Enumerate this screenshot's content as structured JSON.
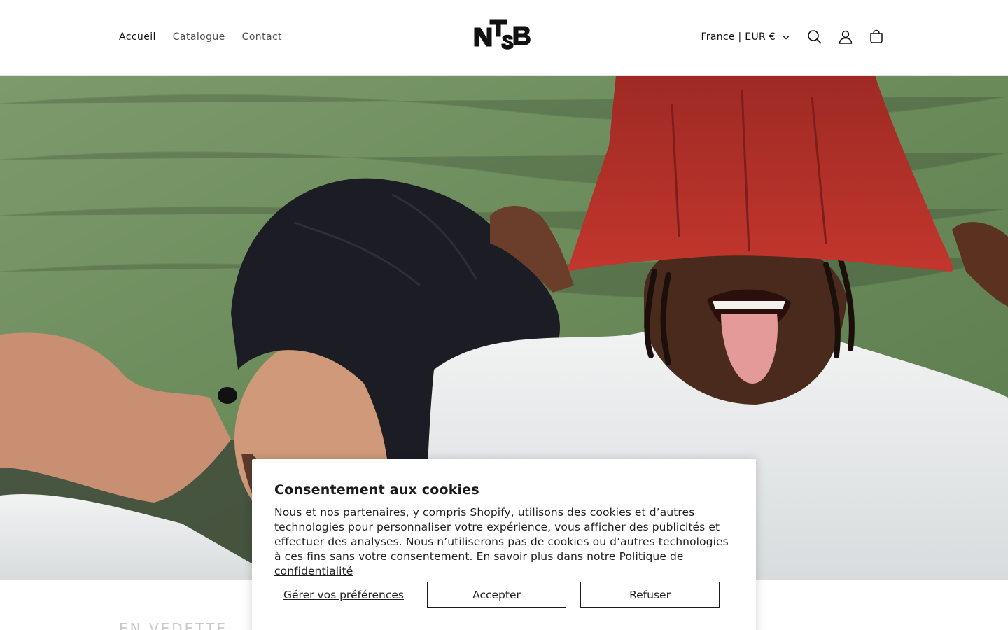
{
  "header": {
    "nav": [
      {
        "label": "Accueil",
        "active": true
      },
      {
        "label": "Catalogue",
        "active": false
      },
      {
        "label": "Contact",
        "active": false
      }
    ],
    "logo_text": "NTSB",
    "locale": "France | EUR €",
    "icons": [
      "search-icon",
      "account-icon",
      "cart-icon"
    ]
  },
  "hero": {
    "image": "two men in oversized beanies (black and red) and white t-shirts against a green background"
  },
  "below": {
    "heading": "EN VEDETTE"
  },
  "cookie": {
    "title": "Consentement aux cookies",
    "text": "Nous et nos partenaires, y compris Shopify, utilisons des cookies et d’autres technologies pour personnaliser votre expérience, vous afficher des publicités et effectuer des analyses. Nous n’utiliserons pas de cookies ou d’autres technologies à ces fins sans votre consentement. En savoir plus dans notre",
    "privacy_link": "Politique de confidentialité",
    "manage_label": "Gérer vos préférences",
    "accept_label": "Accepter",
    "decline_label": "Refuser"
  },
  "colors": {
    "text": "#121212",
    "hero_bg": "#6a8a5c",
    "beanie_red": "#b8302a",
    "beanie_black": "#1c1c24"
  }
}
